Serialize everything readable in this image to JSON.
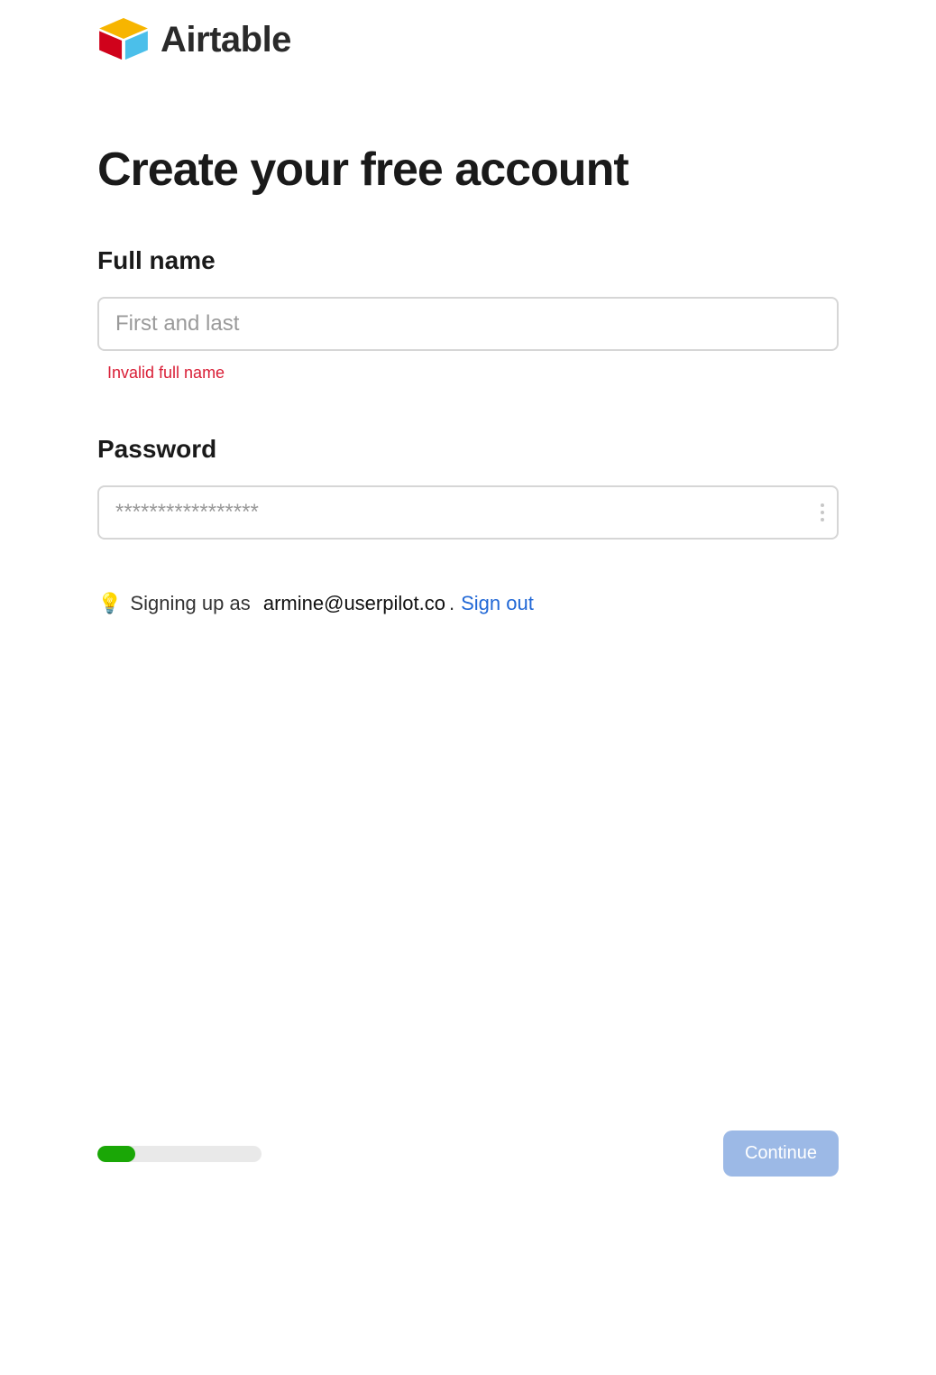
{
  "brand": {
    "name": "Airtable"
  },
  "page": {
    "title": "Create your free account"
  },
  "form": {
    "fullname": {
      "label": "Full name",
      "placeholder": "First and last",
      "value": "",
      "error": "Invalid full name"
    },
    "password": {
      "label": "Password",
      "placeholder": "*****************",
      "value": ""
    }
  },
  "signup_info": {
    "bulb": "💡",
    "prefix": "Signing up as",
    "email": "armine@userpilot.co",
    "suffix": ".",
    "signout": "Sign out"
  },
  "footer": {
    "progress_percent": 23,
    "continue": "Continue"
  }
}
